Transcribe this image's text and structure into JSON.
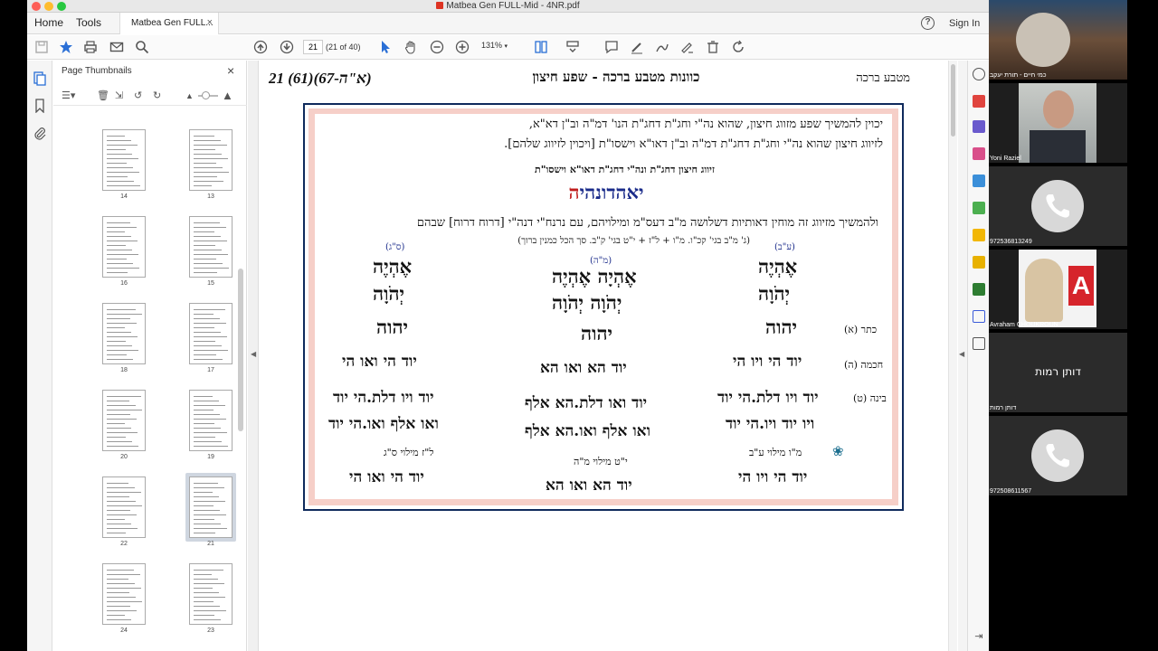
{
  "window": {
    "title": "Matbea Gen FULL-Mid - 4NR.pdf"
  },
  "menu": {
    "home": "Home",
    "tools": "Tools",
    "doc_tab": "Matbea Gen FULL...",
    "tab_close": "×",
    "help": "?",
    "sign_in": "Sign In"
  },
  "toolbar": {
    "page_value": "21",
    "page_count": "(21 of 40)",
    "zoom": "131%"
  },
  "thumbnails": {
    "title": "Page Thumbnails",
    "close": "×",
    "pages": [
      {
        "num": "14"
      },
      {
        "num": "13"
      },
      {
        "num": "16"
      },
      {
        "num": "15"
      },
      {
        "num": "18"
      },
      {
        "num": "17"
      },
      {
        "num": "20"
      },
      {
        "num": "19"
      },
      {
        "num": "22"
      },
      {
        "num": "21"
      },
      {
        "num": "24"
      },
      {
        "num": "23"
      }
    ],
    "selected": "21"
  },
  "document": {
    "header_left": "21 (61)(67-א\"ה)",
    "header_center": "כוונות מטבע ברכה - שפע חיצון",
    "header_right": "מטבע ברכה",
    "intro_line1": "יכוין להמשיך שפע מזווג חיצון, שהוא נה\"י וחג\"ת דחג\"ת הנו' דמ\"ה וב\"ן דא\"א,",
    "intro_line2": "לזיווג חיצון שהוא נה\"י וחג\"ת דחג\"ת דמ\"ה וב\"ן דאו\"א וישסו\"ת [ויכוין לזיווג שלהם].",
    "zivug_title": "זיווג חיצון דחג\"ת ונה\"י דחג\"ת דאו\"א וישסו\"ת",
    "name_parts": [
      "יאהדונהי",
      "ה"
    ],
    "mishech": "ולהמשיך מזיווג זה מוחין דאותיות דשלושה מ\"ב דעס\"מ ומילויהם, עם נרנח\"י דנה\"י [דרוח דרוח] שבהם",
    "gematria": "(ג' מ\"ב בגי' קכ\"ו. מ\"ו + ל\"ז + י\"ט בגי' ק\"ב. סך הכל כמנין ברוך)",
    "columns": {
      "right_tag": "(ע\"ב)",
      "center_tag": "(מ\"ה)",
      "left_tag": "(ס\"ג)",
      "right_ehye": "אֶהְיֶה",
      "right_yhvh1": "יְהֹוָה",
      "right_yhvh2": "יהוה",
      "center_ehye": "אֶהְיָה אֶהְיֶה",
      "center_yhvh1": "יְהֹוָה יְהֹוָה",
      "center_yhvh2": "יהוה",
      "left_ehye": "אֶהְיֶה",
      "left_yhvh1": "יְהֹוָה",
      "left_yhvh2": "יהוה",
      "label_keter": "כתר (א)",
      "label_chochma": "חכמה (ה)",
      "label_bina": "בינה (ט)",
      "right_chochma": "יוד הי ויו הי",
      "center_chochma": "יוד הא ואו הא",
      "left_chochma": "יוד הי ואו הי",
      "right_bina1": "יוד ויו דלת.הי יוד",
      "right_bina2": "ויו יוד ויו.הי יוד",
      "center_bina1": "יוד ואו דלת.הא אלף",
      "center_bina2": "ואו אלף ואו.הא אלף",
      "left_bina1": "יוד ויו דלת.הי יוד",
      "left_bina2": "ואו אלף ואו.הי יוד",
      "right_milui_lbl": "מ\"ו מילוי ע\"ב",
      "center_milui_lbl": "י\"ט מילוי מ\"ה",
      "left_milui_lbl": "ל\"ז מילוי ס\"ג",
      "right_milui": "יוד הי ויו הי",
      "center_milui": "יוד הא ואו הא",
      "left_milui": "יוד הי ואו הי"
    }
  },
  "video": {
    "tiles": [
      {
        "name": "כמי חיים - תורת יעקב"
      },
      {
        "name": "Yoni Raziel"
      },
      {
        "name": "972536813249"
      },
      {
        "name": "Avraham CHOUKROUN"
      },
      {
        "name": "דותן רמות",
        "center": "דותן רמות"
      },
      {
        "name": "972508611567"
      }
    ]
  },
  "colors": {
    "accent_blue": "#1a2b8a",
    "accent_red": "#c01d1d",
    "frame_navy": "#0f2a5c",
    "frame_pink": "#f6cfc8"
  }
}
